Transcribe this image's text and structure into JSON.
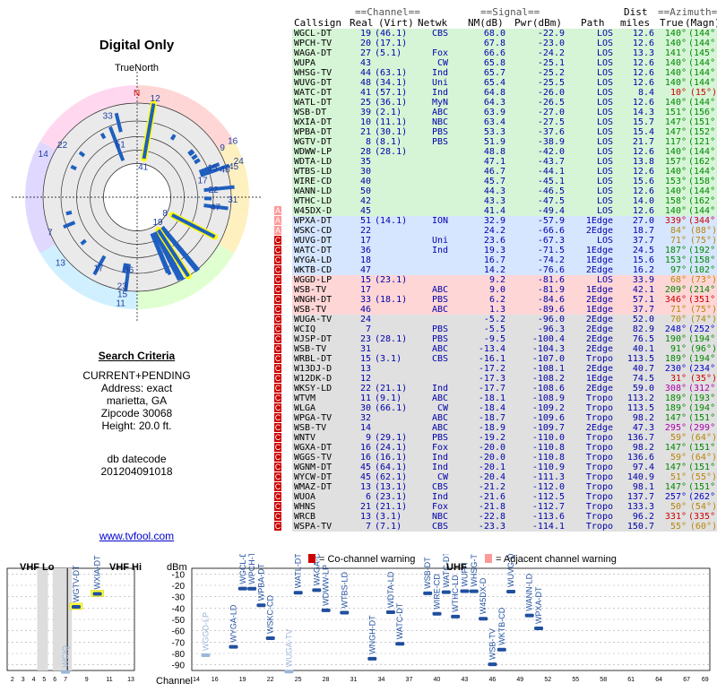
{
  "left_panel": {
    "title": "Digital Only",
    "true_north": "TrueNorth",
    "north_letter": "N",
    "criteria_heading": "Search Criteria",
    "criteria_lines": [
      "CURRENT+PENDING",
      "Address: exact",
      "marietta, GA",
      "Zipcode 30068",
      "Height: 20.0 ft."
    ],
    "datecode_label": "db datecode",
    "datecode": "201204091018",
    "link": "www.tvfool.com"
  },
  "table_header": {
    "channel_group": "==Channel==",
    "signal_group": "==Signal==",
    "azimuth_group": "==Azimuth==",
    "dist_top": "Dist",
    "callsign": "Callsign",
    "real": "Real",
    "virt": "(Virt)",
    "netwk": "Netwk",
    "nm": "NM(dB)",
    "pwr": "Pwr(dBm)",
    "path": "Path",
    "miles": "miles",
    "true": "True",
    "magn": "(Magn)"
  },
  "colors": {
    "green": "#d6f5d6",
    "blue": "#d6e6ff",
    "red": "#ffd6d6",
    "gray": "#e0e0e0",
    "text_blue": "#0000aa",
    "warn_red": "#cc0000"
  },
  "stations": [
    {
      "cs": "WGCL-DT",
      "real": "19",
      "virt": "(46.1)",
      "net": "CBS",
      "nm": "68.0",
      "pwr": "-22.9",
      "path": "LOS",
      "dist": "12.6",
      "true": "140°",
      "magn": "(144°)",
      "bg": "green",
      "warn": ""
    },
    {
      "cs": "WPCH-TV",
      "real": "20",
      "virt": "(17.1)",
      "net": "",
      "nm": "67.8",
      "pwr": "-23.0",
      "path": "LOS",
      "dist": "12.6",
      "true": "140°",
      "magn": "(144°)",
      "bg": "green",
      "warn": ""
    },
    {
      "cs": "WAGA-DT",
      "real": "27",
      "virt": "(5.1)",
      "net": "Fox",
      "nm": "66.6",
      "pwr": "-24.2",
      "path": "LOS",
      "dist": "13.3",
      "true": "141°",
      "magn": "(145°)",
      "bg": "green",
      "warn": ""
    },
    {
      "cs": "WUPA",
      "real": "43",
      "virt": "",
      "net": "CW",
      "nm": "65.8",
      "pwr": "-25.1",
      "path": "LOS",
      "dist": "12.6",
      "true": "140°",
      "magn": "(144°)",
      "bg": "green",
      "warn": ""
    },
    {
      "cs": "WHSG-TV",
      "real": "44",
      "virt": "(63.1)",
      "net": "Ind",
      "nm": "65.7",
      "pwr": "-25.2",
      "path": "LOS",
      "dist": "12.6",
      "true": "140°",
      "magn": "(144°)",
      "bg": "green",
      "warn": ""
    },
    {
      "cs": "WUVG-DT",
      "real": "48",
      "virt": "(34.1)",
      "net": "Uni",
      "nm": "65.4",
      "pwr": "-25.5",
      "path": "LOS",
      "dist": "12.6",
      "true": "140°",
      "magn": "(144°)",
      "bg": "green",
      "warn": ""
    },
    {
      "cs": "WATC-DT",
      "real": "41",
      "virt": "(57.1)",
      "net": "Ind",
      "nm": "64.8",
      "pwr": "-26.0",
      "path": "LOS",
      "dist": "8.4",
      "true": "10°",
      "magn": "(15°)",
      "bg": "green",
      "warn": "",
      "azcol": "#cc0000"
    },
    {
      "cs": "WATL-DT",
      "real": "25",
      "virt": "(36.1)",
      "net": "MyN",
      "nm": "64.3",
      "pwr": "-26.5",
      "path": "LOS",
      "dist": "12.6",
      "true": "140°",
      "magn": "(144°)",
      "bg": "green",
      "warn": ""
    },
    {
      "cs": "WSB-DT",
      "real": "39",
      "virt": "(2.1)",
      "net": "ABC",
      "nm": "63.9",
      "pwr": "-27.0",
      "path": "LOS",
      "dist": "14.3",
      "true": "151°",
      "magn": "(156°)",
      "bg": "green",
      "warn": ""
    },
    {
      "cs": "WXIA-DT",
      "real": "10",
      "virt": "(11.1)",
      "net": "NBC",
      "nm": "63.4",
      "pwr": "-27.5",
      "path": "LOS",
      "dist": "15.7",
      "true": "147°",
      "magn": "(151°)",
      "bg": "green",
      "warn": ""
    },
    {
      "cs": "WPBA-DT",
      "real": "21",
      "virt": "(30.1)",
      "net": "PBS",
      "nm": "53.3",
      "pwr": "-37.6",
      "path": "LOS",
      "dist": "15.4",
      "true": "147°",
      "magn": "(152°)",
      "bg": "green",
      "warn": ""
    },
    {
      "cs": "WGTV-DT",
      "real": "8",
      "virt": "(8.1)",
      "net": "PBS",
      "nm": "51.9",
      "pwr": "-38.9",
      "path": "LOS",
      "dist": "21.7",
      "true": "117°",
      "magn": "(121°)",
      "bg": "green",
      "warn": ""
    },
    {
      "cs": "WDWW-LP",
      "real": "28",
      "virt": "(28.1)",
      "net": "",
      "nm": "48.8",
      "pwr": "-42.0",
      "path": "LOS",
      "dist": "12.6",
      "true": "140°",
      "magn": "(144°)",
      "bg": "green",
      "warn": ""
    },
    {
      "cs": "WDTA-LD",
      "real": "35",
      "virt": "",
      "net": "",
      "nm": "47.1",
      "pwr": "-43.7",
      "path": "LOS",
      "dist": "13.8",
      "true": "157°",
      "magn": "(162°)",
      "bg": "green",
      "warn": ""
    },
    {
      "cs": "WTBS-LD",
      "real": "30",
      "virt": "",
      "net": "",
      "nm": "46.7",
      "pwr": "-44.1",
      "path": "LOS",
      "dist": "12.6",
      "true": "140°",
      "magn": "(144°)",
      "bg": "green",
      "warn": ""
    },
    {
      "cs": "WIRE-CD",
      "real": "40",
      "virt": "",
      "net": "",
      "nm": "45.7",
      "pwr": "-45.1",
      "path": "LOS",
      "dist": "15.6",
      "true": "153°",
      "magn": "(158°)",
      "bg": "green",
      "warn": ""
    },
    {
      "cs": "WANN-LD",
      "real": "50",
      "virt": "",
      "net": "",
      "nm": "44.3",
      "pwr": "-46.5",
      "path": "LOS",
      "dist": "12.6",
      "true": "140°",
      "magn": "(144°)",
      "bg": "green",
      "warn": ""
    },
    {
      "cs": "WTHC-LD",
      "real": "42",
      "virt": "",
      "net": "",
      "nm": "43.3",
      "pwr": "-47.5",
      "path": "LOS",
      "dist": "14.0",
      "true": "158°",
      "magn": "(162°)",
      "bg": "green",
      "warn": ""
    },
    {
      "cs": "W45DX-D",
      "real": "45",
      "virt": "",
      "net": "",
      "nm": "41.4",
      "pwr": "-49.4",
      "path": "LOS",
      "dist": "12.6",
      "true": "140°",
      "magn": "(144°)",
      "bg": "green",
      "warn": "a"
    },
    {
      "cs": "WPXA-DT",
      "real": "51",
      "virt": "(14.1)",
      "net": "ION",
      "nm": "32.9",
      "pwr": "-57.9",
      "path": "1Edge",
      "dist": "27.0",
      "true": "339°",
      "magn": "(344°)",
      "bg": "blue",
      "warn": "a",
      "azcol": "#cc0000"
    },
    {
      "cs": "WSKC-CD",
      "real": "22",
      "virt": "",
      "net": "",
      "nm": "24.2",
      "pwr": "-66.6",
      "path": "2Edge",
      "dist": "18.7",
      "true": "84°",
      "magn": "(88°)",
      "bg": "blue",
      "warn": "a",
      "azcol": "#b8860b"
    },
    {
      "cs": "WUVG-DT",
      "real": "17",
      "virt": "",
      "net": "Uni",
      "nm": "23.6",
      "pwr": "-67.3",
      "path": "LOS",
      "dist": "37.7",
      "true": "71°",
      "magn": "(75°)",
      "bg": "blue",
      "warn": "c",
      "azcol": "#b8860b"
    },
    {
      "cs": "WATC-DT",
      "real": "36",
      "virt": "",
      "net": "Ind",
      "nm": "19.3",
      "pwr": "-71.5",
      "path": "1Edge",
      "dist": "24.5",
      "true": "187°",
      "magn": "(192°)",
      "bg": "blue",
      "warn": "c"
    },
    {
      "cs": "WYGA-LD",
      "real": "18",
      "virt": "",
      "net": "",
      "nm": "16.7",
      "pwr": "-74.2",
      "path": "1Edge",
      "dist": "15.6",
      "true": "153°",
      "magn": "(158°)",
      "bg": "blue",
      "warn": "c"
    },
    {
      "cs": "WKTB-CD",
      "real": "47",
      "virt": "",
      "net": "",
      "nm": "14.2",
      "pwr": "-76.6",
      "path": "2Edge",
      "dist": "16.2",
      "true": "97°",
      "magn": "(102°)",
      "bg": "blue",
      "warn": "c"
    },
    {
      "cs": "WGGD-LP",
      "real": "15",
      "virt": "(23.1)",
      "net": "",
      "nm": "9.2",
      "pwr": "-81.6",
      "path": "LOS",
      "dist": "33.9",
      "true": "68°",
      "magn": "(73°)",
      "bg": "red",
      "warn": "c",
      "azcol": "#b8860b"
    },
    {
      "cs": "WSB-TV",
      "real": "17",
      "virt": "",
      "net": "ABC",
      "nm": "9.0",
      "pwr": "-81.9",
      "path": "1Edge",
      "dist": "42.1",
      "true": "209°",
      "magn": "(214°)",
      "bg": "red",
      "warn": "c"
    },
    {
      "cs": "WNGH-DT",
      "real": "33",
      "virt": "(18.1)",
      "net": "PBS",
      "nm": "6.2",
      "pwr": "-84.6",
      "path": "2Edge",
      "dist": "57.1",
      "true": "346°",
      "magn": "(351°)",
      "bg": "red",
      "warn": "c",
      "azcol": "#cc0000"
    },
    {
      "cs": "WSB-TV",
      "real": "46",
      "virt": "",
      "net": "ABC",
      "nm": "1.3",
      "pwr": "-89.6",
      "path": "1Edge",
      "dist": "37.7",
      "true": "71°",
      "magn": "(75°)",
      "bg": "red",
      "warn": "c",
      "azcol": "#b8860b"
    },
    {
      "cs": "WUGA-TV",
      "real": "24",
      "virt": "",
      "net": "",
      "nm": "-5.2",
      "pwr": "-96.0",
      "path": "2Edge",
      "dist": "52.0",
      "true": "70°",
      "magn": "(74°)",
      "bg": "gray",
      "warn": "c",
      "azcol": "#b8860b"
    },
    {
      "cs": "WCIQ",
      "real": "7",
      "virt": "",
      "net": "PBS",
      "nm": "-5.5",
      "pwr": "-96.3",
      "path": "2Edge",
      "dist": "82.9",
      "true": "248°",
      "magn": "(252°)",
      "bg": "gray",
      "warn": "c",
      "azcol": "#0000cc"
    },
    {
      "cs": "WJSP-DT",
      "real": "23",
      "virt": "(28.1)",
      "net": "PBS",
      "nm": "-9.5",
      "pwr": "-100.4",
      "path": "2Edge",
      "dist": "76.5",
      "true": "190°",
      "magn": "(194°)",
      "bg": "gray",
      "warn": "c"
    },
    {
      "cs": "WSB-TV",
      "real": "31",
      "virt": "",
      "net": "ABC",
      "nm": "-13.4",
      "pwr": "-104.3",
      "path": "2Edge",
      "dist": "40.1",
      "true": "91°",
      "magn": "(96°)",
      "bg": "gray",
      "warn": "c"
    },
    {
      "cs": "WRBL-DT",
      "real": "15",
      "virt": "(3.1)",
      "net": "CBS",
      "nm": "-16.1",
      "pwr": "-107.0",
      "path": "Tropo",
      "dist": "113.5",
      "true": "189°",
      "magn": "(194°)",
      "bg": "gray",
      "warn": "c"
    },
    {
      "cs": "W13DJ-D",
      "real": "13",
      "virt": "",
      "net": "",
      "nm": "-17.2",
      "pwr": "-108.1",
      "path": "2Edge",
      "dist": "40.7",
      "true": "230°",
      "magn": "(234°)",
      "bg": "gray",
      "warn": "c",
      "azcol": "#0000cc"
    },
    {
      "cs": "W12DK-D",
      "real": "12",
      "virt": "",
      "net": "",
      "nm": "-17.3",
      "pwr": "-108.2",
      "path": "1Edge",
      "dist": "74.5",
      "true": "31°",
      "magn": "(35°)",
      "bg": "gray",
      "warn": "c",
      "azcol": "#cc0000"
    },
    {
      "cs": "WKSY-LD",
      "real": "22",
      "virt": "(21.1)",
      "net": "Ind",
      "nm": "-17.7",
      "pwr": "-108.6",
      "path": "2Edge",
      "dist": "59.0",
      "true": "308°",
      "magn": "(312°)",
      "bg": "gray",
      "warn": "c",
      "azcol": "#aa00aa"
    },
    {
      "cs": "WTVM",
      "real": "11",
      "virt": "(9.1)",
      "net": "ABC",
      "nm": "-18.1",
      "pwr": "-108.9",
      "path": "Tropo",
      "dist": "113.2",
      "true": "189°",
      "magn": "(193°)",
      "bg": "gray",
      "warn": "c"
    },
    {
      "cs": "WLGA",
      "real": "30",
      "virt": "(66.1)",
      "net": "CW",
      "nm": "-18.4",
      "pwr": "-109.2",
      "path": "Tropo",
      "dist": "113.5",
      "true": "189°",
      "magn": "(194°)",
      "bg": "gray",
      "warn": "c"
    },
    {
      "cs": "WPGA-TV",
      "real": "32",
      "virt": "",
      "net": "ABC",
      "nm": "-18.7",
      "pwr": "-109.6",
      "path": "Tropo",
      "dist": "98.2",
      "true": "147°",
      "magn": "(151°)",
      "bg": "gray",
      "warn": "c"
    },
    {
      "cs": "WSB-TV",
      "real": "14",
      "virt": "",
      "net": "ABC",
      "nm": "-18.9",
      "pwr": "-109.7",
      "path": "2Edge",
      "dist": "47.3",
      "true": "295°",
      "magn": "(299°)",
      "bg": "gray",
      "warn": "c",
      "azcol": "#aa00aa"
    },
    {
      "cs": "WNTV",
      "real": "9",
      "virt": "(29.1)",
      "net": "PBS",
      "nm": "-19.2",
      "pwr": "-110.0",
      "path": "Tropo",
      "dist": "136.7",
      "true": "59°",
      "magn": "(64°)",
      "bg": "gray",
      "warn": "c",
      "azcol": "#b8860b"
    },
    {
      "cs": "WGXA-DT",
      "real": "16",
      "virt": "(24.1)",
      "net": "Fox",
      "nm": "-20.0",
      "pwr": "-110.8",
      "path": "Tropo",
      "dist": "98.2",
      "true": "147°",
      "magn": "(151°)",
      "bg": "gray",
      "warn": "c"
    },
    {
      "cs": "WGGS-TV",
      "real": "16",
      "virt": "(16.1)",
      "net": "Ind",
      "nm": "-20.0",
      "pwr": "-110.8",
      "path": "Tropo",
      "dist": "136.6",
      "true": "59°",
      "magn": "(64°)",
      "bg": "gray",
      "warn": "c",
      "azcol": "#b8860b"
    },
    {
      "cs": "WGNM-DT",
      "real": "45",
      "virt": "(64.1)",
      "net": "Ind",
      "nm": "-20.1",
      "pwr": "-110.9",
      "path": "Tropo",
      "dist": "97.4",
      "true": "147°",
      "magn": "(151°)",
      "bg": "gray",
      "warn": "c"
    },
    {
      "cs": "WYCW-DT",
      "real": "45",
      "virt": "(62.1)",
      "net": "CW",
      "nm": "-20.4",
      "pwr": "-111.3",
      "path": "Tropo",
      "dist": "140.9",
      "true": "51°",
      "magn": "(55°)",
      "bg": "gray",
      "warn": "c",
      "azcol": "#b8860b"
    },
    {
      "cs": "WMAZ-DT",
      "real": "13",
      "virt": "(13.1)",
      "net": "CBS",
      "nm": "-21.2",
      "pwr": "-112.0",
      "path": "Tropo",
      "dist": "98.1",
      "true": "147°",
      "magn": "(151°)",
      "bg": "gray",
      "warn": "c"
    },
    {
      "cs": "WUOA",
      "real": "6",
      "virt": "(23.1)",
      "net": "Ind",
      "nm": "-21.6",
      "pwr": "-112.5",
      "path": "Tropo",
      "dist": "137.7",
      "true": "257°",
      "magn": "(262°)",
      "bg": "gray",
      "warn": "c",
      "azcol": "#0000cc"
    },
    {
      "cs": "WHNS",
      "real": "21",
      "virt": "(21.1)",
      "net": "Fox",
      "nm": "-21.8",
      "pwr": "-112.7",
      "path": "Tropo",
      "dist": "133.3",
      "true": "50°",
      "magn": "(54°)",
      "bg": "gray",
      "warn": "c",
      "azcol": "#b8860b"
    },
    {
      "cs": "WRCB",
      "real": "13",
      "virt": "(3.1)",
      "net": "NBC",
      "nm": "-22.8",
      "pwr": "-113.6",
      "path": "Tropo",
      "dist": "96.2",
      "true": "331°",
      "magn": "(335°)",
      "bg": "gray",
      "warn": "c",
      "azcol": "#cc0000"
    },
    {
      "cs": "WSPA-TV",
      "real": "7",
      "virt": "(7.1)",
      "net": "CBS",
      "nm": "-23.3",
      "pwr": "-114.1",
      "path": "Tropo",
      "dist": "150.7",
      "true": "55°",
      "magn": "(60°)",
      "bg": "gray",
      "warn": "c",
      "azcol": "#b8860b"
    }
  ],
  "polar_labels": [
    {
      "t": "12",
      "az": 10,
      "r": 0.9
    },
    {
      "t": "33",
      "az": 340,
      "r": 0.78
    },
    {
      "t": "22",
      "az": 305,
      "r": 0.82
    },
    {
      "t": "14",
      "az": 295,
      "r": 0.93
    },
    {
      "t": "51",
      "az": 342,
      "r": 0.5
    },
    {
      "t": "41",
      "az": 10,
      "r": 0.28
    },
    {
      "t": "9",
      "az": 60,
      "r": 0.9
    },
    {
      "t": "16",
      "az": 59,
      "r": 0.99
    },
    {
      "t": "45",
      "az": 72,
      "r": 0.9
    },
    {
      "t": "46",
      "az": 72,
      "r": 0.82
    },
    {
      "t": "15",
      "az": 68,
      "r": 0.72
    },
    {
      "t": "24",
      "az": 70,
      "r": 0.96
    },
    {
      "t": "17",
      "az": 75,
      "r": 0.6
    },
    {
      "t": "22",
      "az": 84,
      "r": 0.68
    },
    {
      "t": "31",
      "az": 91,
      "r": 0.85
    },
    {
      "t": "47",
      "az": 97,
      "r": 0.7
    },
    {
      "t": "8",
      "az": 117,
      "r": 0.3
    },
    {
      "t": "19",
      "az": 140,
      "r": 0.28
    },
    {
      "t": "7",
      "az": 248,
      "r": 0.82
    },
    {
      "t": "13",
      "az": 230,
      "r": 0.9
    },
    {
      "t": "17",
      "az": 209,
      "r": 0.72
    },
    {
      "t": "36",
      "az": 187,
      "r": 0.65
    },
    {
      "t": "23",
      "az": 190,
      "r": 0.8
    },
    {
      "t": "15",
      "az": 189,
      "r": 0.87
    },
    {
      "t": "11",
      "az": 189,
      "r": 0.95
    }
  ],
  "bottom": {
    "vhf_lo": "VHF Lo",
    "vhf_hi": "VHF Hi",
    "uhf": "UHF",
    "dbm_label": "dBm",
    "channel_label": "Channel",
    "cochannel_warning": "= Co-channel warning",
    "adjacent_warning": "= Adjacent channel warning",
    "dbm_ticks": [
      "-10",
      "-20",
      "-30",
      "-40",
      "-50",
      "-60",
      "-70",
      "-80",
      "-90"
    ],
    "vhf_lo_channels": [
      "2",
      "3",
      "4",
      "5",
      "6"
    ],
    "vhf_hi_channels": [
      "7",
      "9",
      "11",
      "13"
    ],
    "uhf_channels": [
      "14",
      "16",
      "19",
      "22",
      "25",
      "28",
      "31",
      "34",
      "37",
      "40",
      "43",
      "46",
      "49",
      "52",
      "55",
      "58",
      "61",
      "64",
      "67",
      "69"
    ]
  },
  "bar_data": [
    {
      "cs": "WGTV-DT",
      "ch": 8,
      "pwr": -38.9,
      "hl": true
    },
    {
      "cs": "WXIA-DT",
      "ch": 10,
      "pwr": -27.5,
      "hl": true
    },
    {
      "cs": "WCIQ",
      "ch": 7,
      "pwr": -96.3,
      "gray": true
    },
    {
      "cs": "WGCL-DT",
      "ch": 19,
      "pwr": -22.9
    },
    {
      "cs": "WPCH-TV",
      "ch": 20,
      "pwr": -23.0
    },
    {
      "cs": "WPBA-DT",
      "ch": 21,
      "pwr": -37.6
    },
    {
      "cs": "WSKC-CD",
      "ch": 22,
      "pwr": -66.6
    },
    {
      "cs": "WYGA-LD",
      "ch": 18,
      "pwr": -74.2
    },
    {
      "cs": "WGGD-LP",
      "ch": 15,
      "pwr": -81.6,
      "gray": true
    },
    {
      "cs": "WUGA-TV",
      "ch": 24,
      "pwr": -96.0,
      "gray": true
    },
    {
      "cs": "WATL-DT",
      "ch": 25,
      "pwr": -26.5
    },
    {
      "cs": "WAGA-DT",
      "ch": 27,
      "pwr": -24.2
    },
    {
      "cs": "WDWW-LP",
      "ch": 28,
      "pwr": -42.0
    },
    {
      "cs": "WTBS-LD",
      "ch": 30,
      "pwr": -44.1
    },
    {
      "cs": "WNGH-DT",
      "ch": 33,
      "pwr": -84.6
    },
    {
      "cs": "WDTA-LD",
      "ch": 35,
      "pwr": -43.7
    },
    {
      "cs": "WATC-DT",
      "ch": 36,
      "pwr": -71.5
    },
    {
      "cs": "WSB-DT",
      "ch": 39,
      "pwr": -27.0
    },
    {
      "cs": "WIRE-CD",
      "ch": 40,
      "pwr": -45.1
    },
    {
      "cs": "WATC-DT",
      "ch": 41,
      "pwr": -26.0
    },
    {
      "cs": "WTHC-LD",
      "ch": 42,
      "pwr": -47.5
    },
    {
      "cs": "WUPA",
      "ch": 43,
      "pwr": -25.1
    },
    {
      "cs": "WHSG-TV",
      "ch": 44,
      "pwr": -25.2
    },
    {
      "cs": "W45DX-D",
      "ch": 45,
      "pwr": -49.4
    },
    {
      "cs": "WSB-TV",
      "ch": 46,
      "pwr": -89.6
    },
    {
      "cs": "WKTB-CD",
      "ch": 47,
      "pwr": -76.6
    },
    {
      "cs": "WUVG-DT",
      "ch": 48,
      "pwr": -25.5
    },
    {
      "cs": "WANN-LD",
      "ch": 50,
      "pwr": -46.5
    },
    {
      "cs": "WPXA-DT",
      "ch": 51,
      "pwr": -57.9
    }
  ]
}
